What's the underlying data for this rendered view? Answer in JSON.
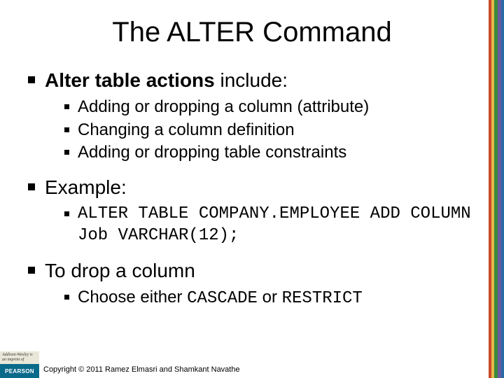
{
  "title": "The ALTER Command",
  "sections": [
    {
      "heading_bold": "Alter table actions",
      "heading_rest": " include:",
      "items": [
        {
          "text": "Adding or dropping a column (attribute)"
        },
        {
          "text": "Changing a column definition"
        },
        {
          "text": "Adding or dropping table constraints"
        }
      ]
    },
    {
      "heading_bold": "",
      "heading_rest": "Example:",
      "items": [
        {
          "code": "ALTER TABLE COMPANY.EMPLOYEE ADD COLUMN Job VARCHAR(12);"
        }
      ]
    },
    {
      "heading_bold": "",
      "heading_rest": "To drop a column",
      "items": [
        {
          "mixed_pre": "Choose either ",
          "mixed_code1": "CASCADE",
          "mixed_mid": " or ",
          "mixed_code2": "RESTRICT"
        }
      ]
    }
  ],
  "footer": {
    "aw": "Addison-Wesley is an imprint of",
    "pearson": "PEARSON",
    "copyright": "Copyright © 2011 Ramez Elmasri and Shamkant Navathe"
  }
}
